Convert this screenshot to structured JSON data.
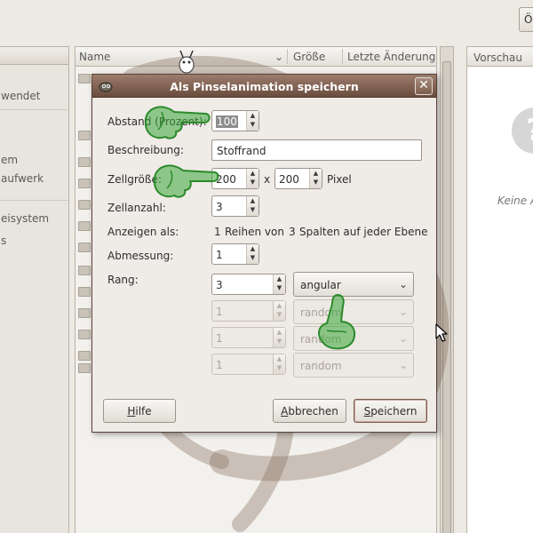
{
  "chooser": {
    "open_button": "Ö",
    "places_items": [
      {
        "label": "wendet"
      },
      {
        "label": "em"
      },
      {
        "label": "aufwerk"
      },
      {
        "label": "eisystem"
      },
      {
        "label": "s"
      }
    ],
    "columns": {
      "name": "Name",
      "size": "Größe",
      "modified": "Letzte Änderung"
    },
    "preview": {
      "header": "Vorschau",
      "empty_text": "Keine A",
      "question": "?"
    }
  },
  "dialog": {
    "title": "Als Pinselanimation speichern",
    "close_glyph": "✕",
    "fields": {
      "spacing": {
        "label": "Abstand (Prozent):",
        "value": "100"
      },
      "description": {
        "label": "Beschreibung:",
        "value": "Stoffrand"
      },
      "cell_size": {
        "label": "Zellgröße:",
        "width": "200",
        "separator": "x",
        "height": "200",
        "unit": "Pixel"
      },
      "cell_count": {
        "label": "Zellanzahl:",
        "value": "3"
      },
      "display_as": {
        "label": "Anzeigen als:",
        "rows_value": "1",
        "rows_text": "Reihen von",
        "cols_value": "3",
        "cols_text": "Spalten auf jeder Ebene"
      },
      "dimension": {
        "label": "Abmessung:",
        "value": "1"
      },
      "ranks": {
        "label": "Rang:",
        "rows": [
          {
            "value": "3",
            "selection": "angular",
            "enabled": true
          },
          {
            "value": "1",
            "selection": "random",
            "enabled": false
          },
          {
            "value": "1",
            "selection": "random",
            "enabled": false
          },
          {
            "value": "1",
            "selection": "random",
            "enabled": false
          }
        ]
      }
    },
    "buttons": {
      "help": {
        "mnemonic": "H",
        "rest": "ilfe"
      },
      "cancel": {
        "mnemonic": "A",
        "rest": "bbrechen"
      },
      "save": {
        "mnemonic": "S",
        "rest": "peichern"
      }
    }
  },
  "colors": {
    "titlebar": "#7d5f50",
    "overlay_green": "#3aa83a",
    "watermark": "#8a7060"
  }
}
